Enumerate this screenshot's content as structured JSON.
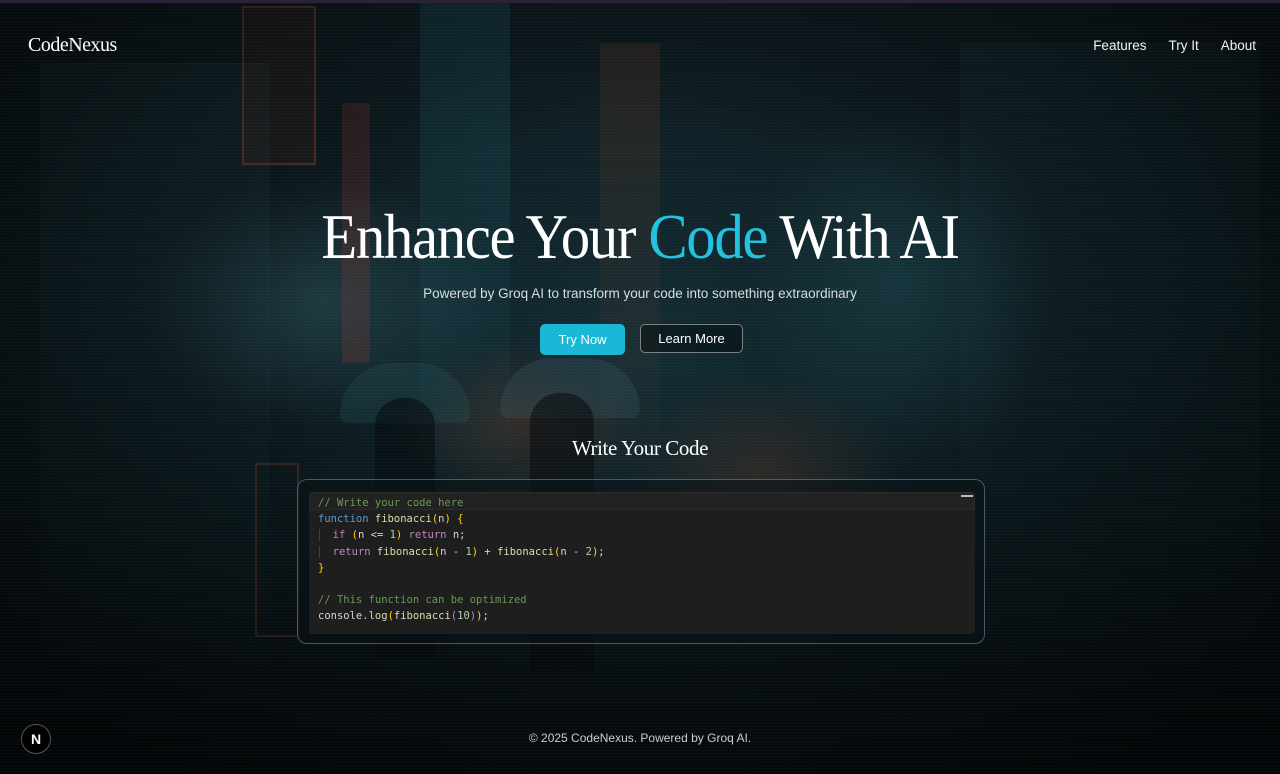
{
  "header": {
    "logo": "CodeNexus",
    "nav": [
      "Features",
      "Try It",
      "About"
    ]
  },
  "hero": {
    "title_before": "Enhance Your ",
    "title_accent": "Code",
    "title_after": " With AI",
    "subtitle": "Powered by Groq AI to transform your code into something extraordinary",
    "primary_button": "Try Now",
    "secondary_button": "Learn More"
  },
  "editor_section": {
    "title": "Write Your Code",
    "code_lines": [
      "// Write your code here",
      "function fibonacci(n) {",
      "  if (n <= 1) return n;",
      "  return fibonacci(n - 1) + fibonacci(n - 2);",
      "}",
      "",
      "// This function can be optimized",
      "console.log(fibonacci(10));"
    ]
  },
  "footer": {
    "text": "© 2025 CodeNexus. Powered by Groq AI."
  },
  "dev_badge": {
    "label": "N",
    "icon": "nextjs-icon"
  },
  "colors": {
    "accent": "#1ab7d6",
    "background": "#0b1418",
    "editor_bg": "#1e1e1e"
  }
}
